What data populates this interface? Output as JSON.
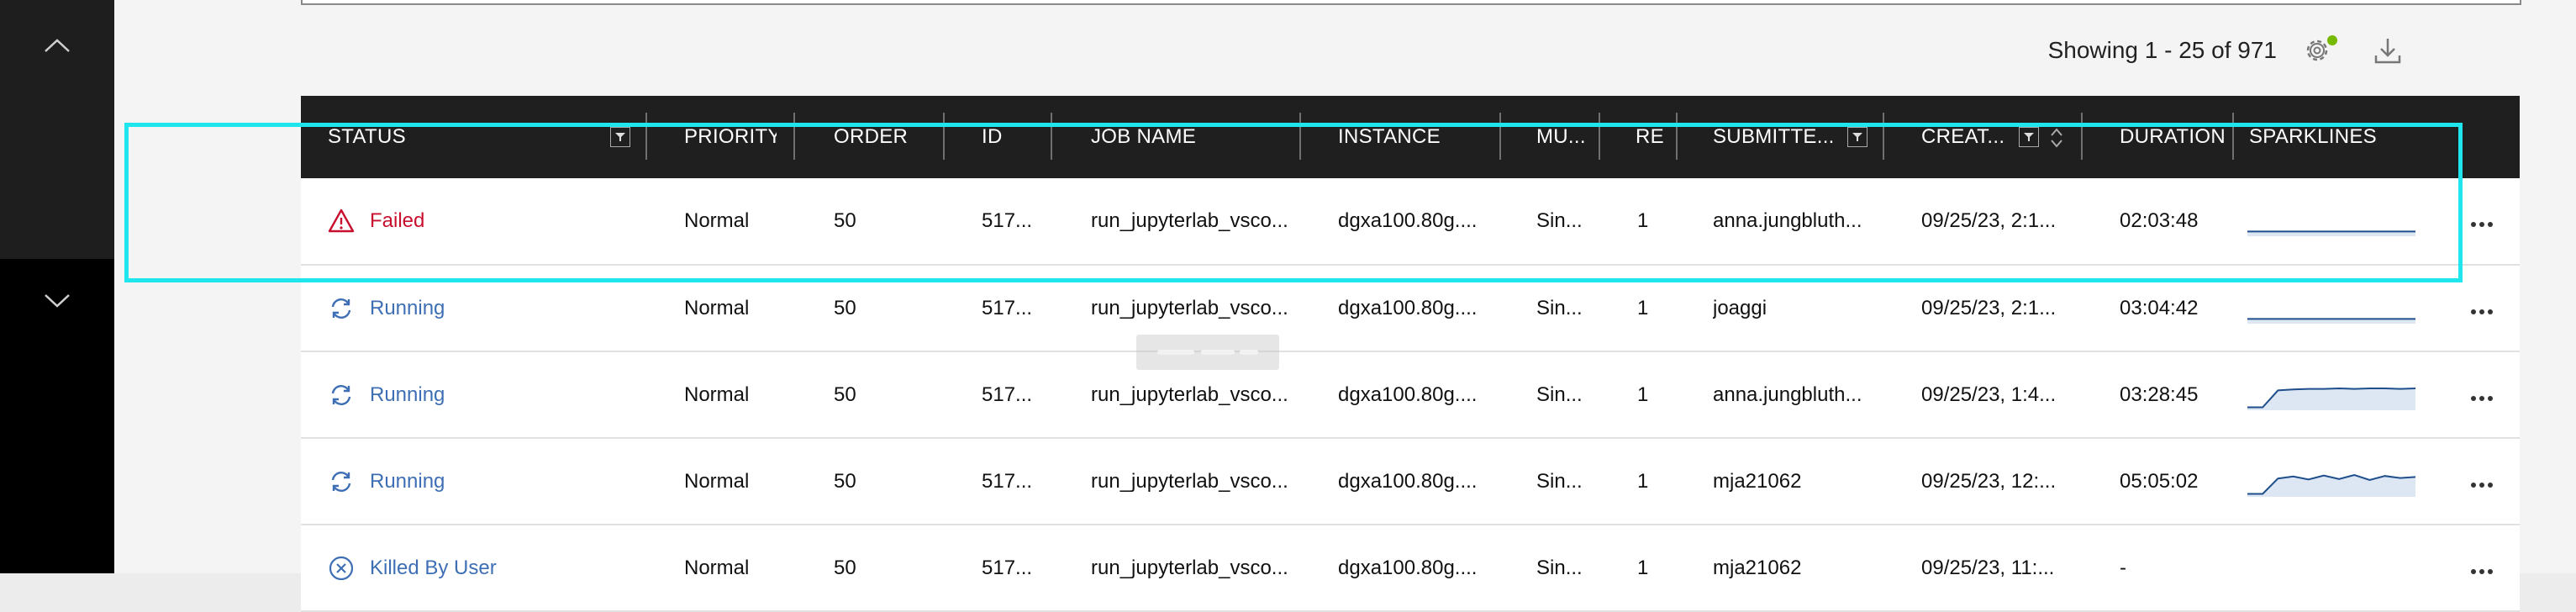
{
  "toolbar": {
    "showing": "Showing 1 - 25 of 971",
    "settings_icon": "gear-icon",
    "download_icon": "download-icon",
    "notify_color": "#76b900"
  },
  "sidebar": {
    "up_icon": "chevron-up-icon",
    "down_icon": "chevron-down-icon"
  },
  "table": {
    "columns": [
      "STATUS",
      "PRIORITY",
      "ORDER",
      "ID",
      "JOB NAME",
      "INSTANCE",
      "MU...",
      "RE",
      "SUBMITTE...",
      "CREAT...",
      "DURATION",
      "SPARKLINES"
    ],
    "rows": [
      {
        "status": "Failed",
        "status_icon": "warning-icon",
        "priority": "Normal",
        "order": "50",
        "id": "517...",
        "job": "run_jupyterlab_vsco...",
        "instance": "dgxa100.80g....",
        "mu": "Sin...",
        "re": "1",
        "submitter": "anna.jungbluth...",
        "created": "09/25/23, 2:1...",
        "duration": "02:03:48",
        "spark": [
          0.12,
          0.12,
          0.12,
          0.12,
          0.12,
          0.12,
          0.12,
          0.12,
          0.12,
          0.12,
          0.12,
          0.12
        ]
      },
      {
        "status": "Running",
        "status_icon": "sync-icon",
        "priority": "Normal",
        "order": "50",
        "id": "517...",
        "job": "run_jupyterlab_vsco...",
        "instance": "dgxa100.80g....",
        "mu": "Sin...",
        "re": "1",
        "submitter": "joaggi",
        "created": "09/25/23, 2:1...",
        "duration": "03:04:42",
        "spark": [
          0.12,
          0.12,
          0.12,
          0.12,
          0.12,
          0.12,
          0.12,
          0.12,
          0.12,
          0.12,
          0.12,
          0.12
        ]
      },
      {
        "status": "Running",
        "status_icon": "sync-icon",
        "priority": "Normal",
        "order": "50",
        "id": "517...",
        "job": "run_jupyterlab_vsco...",
        "instance": "dgxa100.80g....",
        "mu": "Sin...",
        "re": "1",
        "submitter": "anna.jungbluth...",
        "created": "09/25/23, 1:4...",
        "duration": "03:28:45",
        "spark": [
          0.05,
          0.05,
          0.72,
          0.76,
          0.78,
          0.78,
          0.8,
          0.78,
          0.8,
          0.8,
          0.78,
          0.8
        ]
      },
      {
        "status": "Running",
        "status_icon": "sync-icon",
        "priority": "Normal",
        "order": "50",
        "id": "517...",
        "job": "run_jupyterlab_vsco...",
        "instance": "dgxa100.80g....",
        "mu": "Sin...",
        "re": "1",
        "submitter": "mja21062",
        "created": "09/25/23, 12:...",
        "duration": "05:05:02",
        "spark": [
          0.05,
          0.05,
          0.66,
          0.74,
          0.62,
          0.78,
          0.64,
          0.8,
          0.6,
          0.76,
          0.68,
          0.72
        ]
      },
      {
        "status": "Killed By User",
        "status_icon": "cancel-circle-icon",
        "priority": "Normal",
        "order": "50",
        "id": "517...",
        "job": "run_jupyterlab_vsco...",
        "instance": "dgxa100.80g....",
        "mu": "Sin...",
        "re": "1",
        "submitter": "mja21062",
        "created": "09/25/23, 11:...",
        "duration": "-",
        "spark": []
      }
    ]
  },
  "colors": {
    "failed": "#c8102e",
    "running": "#3e6fb4",
    "header_bg": "#1f1f1f",
    "highlight": "#1ee6ec",
    "sparkline": "#1f4e8c"
  }
}
